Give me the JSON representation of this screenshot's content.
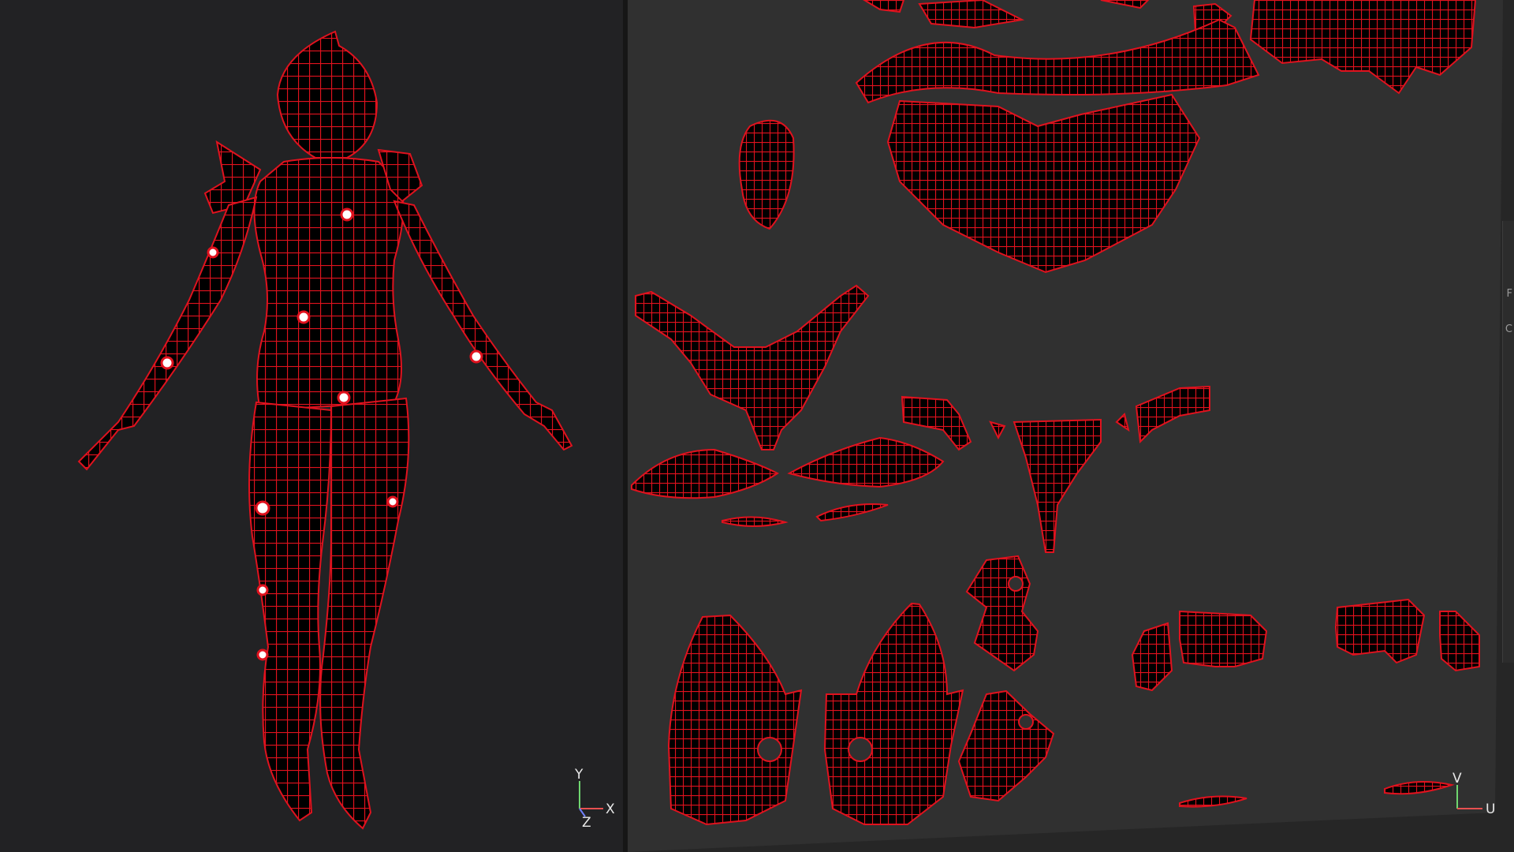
{
  "viewport_3d": {
    "axis": {
      "y": "Y",
      "x": "X",
      "z": "Z"
    }
  },
  "viewport_uv": {
    "axis": {
      "v": "V",
      "u": "U"
    },
    "side_panel_chars": [
      "F",
      "C"
    ]
  },
  "colors": {
    "wire": "#e0121e",
    "fill": "#000000",
    "bg_3d": "#222224",
    "bg_uv": "#303030"
  }
}
